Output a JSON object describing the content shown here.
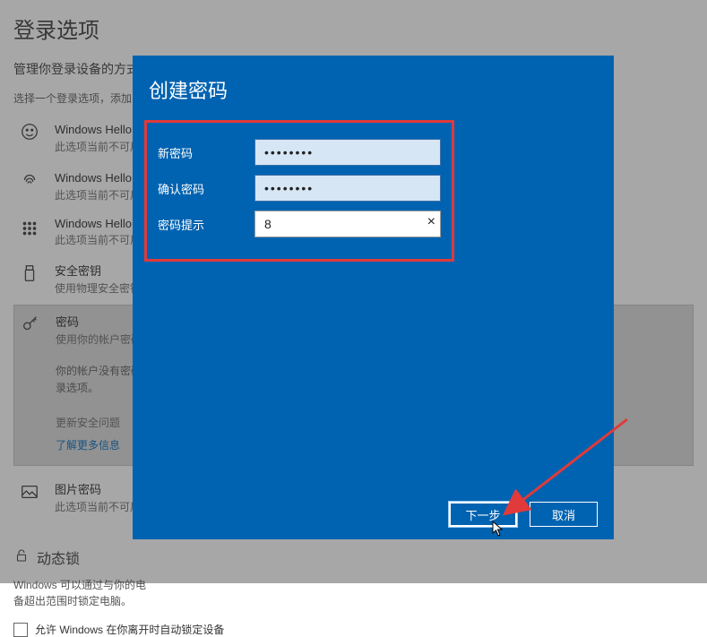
{
  "page": {
    "title": "登录选项",
    "subtitle": "管理你登录设备的方式",
    "hint": "选择一个登录选项，添加、"
  },
  "options": [
    {
      "icon": "face-icon",
      "title": "Windows Hello 人脸",
      "sub": "此选项当前不可用 -"
    },
    {
      "icon": "fingerprint-icon",
      "title": "Windows Hello 指纹",
      "sub": "此选项当前不可用 -"
    },
    {
      "icon": "keypad-icon",
      "title": "Windows Hello PIN",
      "sub": "此选项当前不可用 -"
    },
    {
      "icon": "usb-key-icon",
      "title": "安全密钥",
      "sub": "使用物理安全密钥登"
    },
    {
      "icon": "key-icon",
      "title": "密码",
      "sub": "使用你的帐户密码登",
      "extra": "你的帐户没有密码。\n录选项。",
      "link1": "更新安全问题",
      "link2": "了解更多信息",
      "selected": true
    },
    {
      "icon": "picture-icon",
      "title": "图片密码",
      "sub": "此选项当前不可用"
    }
  ],
  "dynamic_lock": {
    "heading_icon": "lock-icon",
    "heading": "动态锁",
    "text": "Windows 可以通过与你的电\n备超出范围时锁定电脑。",
    "checkbox_label": "允许 Windows 在你离开时自动锁定设备"
  },
  "modal": {
    "title": "创建密码",
    "fields": {
      "new_password": {
        "label": "新密码",
        "value": "••••••••"
      },
      "confirm_password": {
        "label": "确认密码",
        "value": "••••••••"
      },
      "hint": {
        "label": "密码提示",
        "value": "8"
      }
    },
    "clear_glyph": "×",
    "buttons": {
      "next": "下一步",
      "cancel": "取消"
    }
  }
}
